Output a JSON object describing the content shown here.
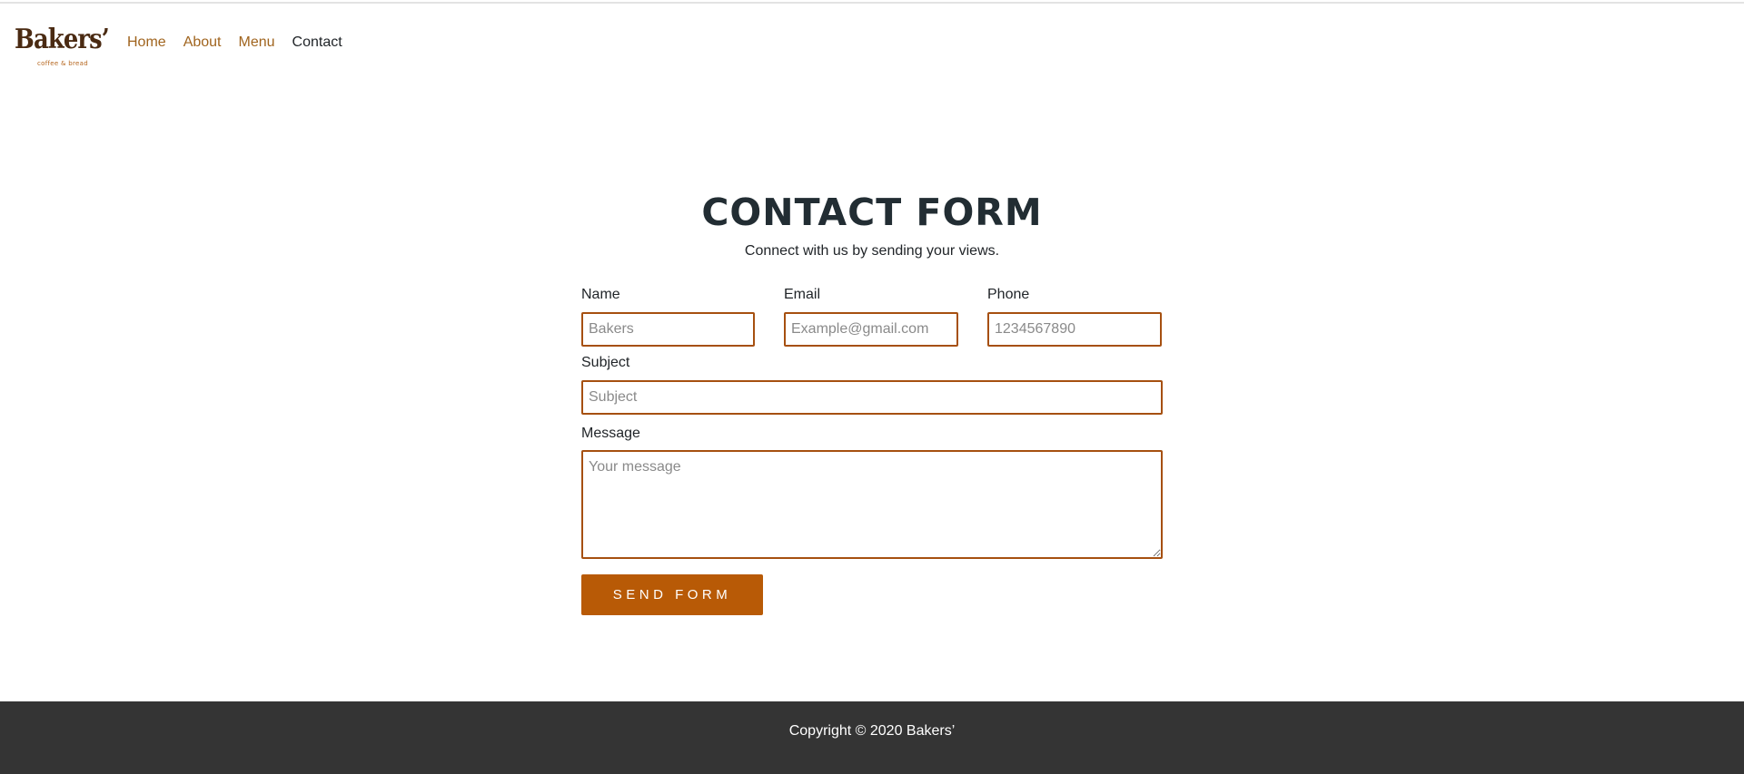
{
  "brand": {
    "name": "Bakers’",
    "tagline": "coffee & bread",
    "colors": {
      "logo": "#4a2a12",
      "accent": "#b85a06",
      "link": "#a0641e",
      "field_border": "#a65010"
    }
  },
  "nav": {
    "items": [
      {
        "label": "Home",
        "active": false
      },
      {
        "label": "About",
        "active": false
      },
      {
        "label": "Menu",
        "active": false
      },
      {
        "label": "Contact",
        "active": true
      }
    ]
  },
  "main": {
    "title": "CONTACT FORM",
    "subtitle": "Connect with us by sending your views."
  },
  "form": {
    "name": {
      "label": "Name",
      "value": "",
      "placeholder": "Bakers"
    },
    "email": {
      "label": "Email",
      "value": "",
      "placeholder": "Example@gmail.com"
    },
    "phone": {
      "label": "Phone",
      "value": "",
      "placeholder": "1234567890"
    },
    "subject": {
      "label": "Subject",
      "value": "",
      "placeholder": "Subject"
    },
    "message": {
      "label": "Message",
      "value": "",
      "placeholder": "Your message"
    },
    "submit_label": "SEND FORM"
  },
  "footer": {
    "copyright": "Copyright © 2020 Bakers’",
    "background": "#343434"
  }
}
